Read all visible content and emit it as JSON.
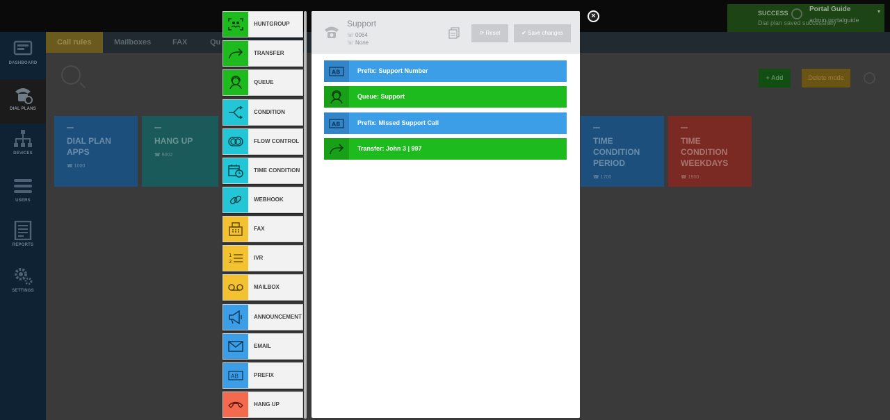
{
  "status": {
    "title": "SUCCESS",
    "subtitle": "Dial plan saved successfully",
    "user_name": "Portal Guide",
    "user_role": "admin.portalguide"
  },
  "sidebar": {
    "items": [
      {
        "label": "DASHBOARD",
        "icon": "dashboard-icon"
      },
      {
        "label": "DIAL PLANS",
        "icon": "dialplan-phone-gear-icon"
      },
      {
        "label": "DEVICES",
        "icon": "devices-network-icon"
      },
      {
        "label": "USERS",
        "icon": "users-icon"
      },
      {
        "label": "REPORTS",
        "icon": "reports-icon"
      },
      {
        "label": "SETTINGS",
        "icon": "settings-gears-icon"
      }
    ]
  },
  "tabs": [
    {
      "label": "Call rules"
    },
    {
      "label": "Mailboxes"
    },
    {
      "label": "FAX"
    },
    {
      "label": "Qu"
    }
  ],
  "toolbar": {
    "add_label": "Add",
    "delete_label": "Delete mode"
  },
  "cards": [
    {
      "title": "DIAL PLAN APPS",
      "number": "1000",
      "color": "#1c4f7c"
    },
    {
      "title": "HANG UP",
      "number": "9002",
      "color": "#1a5a5a"
    },
    {
      "title": "TIME CONDITION PERIOD",
      "number": "1700",
      "color": "#1c4f7c"
    },
    {
      "title": "TIME CONDITION WEEKDAYS",
      "number": "1900",
      "color": "#7a2a22"
    }
  ],
  "palette": {
    "items": [
      {
        "label": "HUNTGROUP",
        "color": "#1ebb1e",
        "icon": "huntgroup-icon"
      },
      {
        "label": "TRANSFER",
        "color": "#1ebb1e",
        "icon": "transfer-arrow-icon"
      },
      {
        "label": "QUEUE",
        "color": "#1ebb1e",
        "icon": "queue-headset-icon"
      },
      {
        "label": "CONDITION",
        "color": "#22c6d6",
        "icon": "condition-split-icon"
      },
      {
        "label": "FLOW CONTROL",
        "color": "#22c6d6",
        "icon": "flow-control-toggle-icon"
      },
      {
        "label": "TIME CONDITION",
        "color": "#22c6d6",
        "icon": "time-condition-calendar-icon"
      },
      {
        "label": "WEBHOOK",
        "color": "#22c6d6",
        "icon": "webhook-link-icon"
      },
      {
        "label": "FAX",
        "color": "#f2c230",
        "icon": "fax-icon"
      },
      {
        "label": "IVR",
        "color": "#f2c230",
        "icon": "ivr-list-icon"
      },
      {
        "label": "MAILBOX",
        "color": "#f2c230",
        "icon": "mailbox-voicemail-icon"
      },
      {
        "label": "ANNOUNCEMENT",
        "color": "#3d9ee8",
        "icon": "announcement-megaphone-icon"
      },
      {
        "label": "EMAIL",
        "color": "#3d9ee8",
        "icon": "email-envelope-icon"
      },
      {
        "label": "PREFIX",
        "color": "#3d9ee8",
        "icon": "prefix-ab-icon"
      },
      {
        "label": "HANG UP",
        "color": "#f36a4e",
        "icon": "hang-up-phone-icon"
      }
    ]
  },
  "panel": {
    "title": "Support",
    "number": "0064",
    "secondary": "None",
    "reset_label": "Reset",
    "save_label": "Save changes",
    "rules": [
      {
        "label": "Prefix: Support Number",
        "type": "prefix",
        "color": "blue"
      },
      {
        "label": "Queue: Support",
        "type": "queue",
        "color": "green"
      },
      {
        "label": "Prefix: Missed Support Call",
        "type": "prefix",
        "color": "blue"
      },
      {
        "label": "Transfer: John 3 | 997",
        "type": "transfer",
        "color": "green"
      }
    ]
  }
}
